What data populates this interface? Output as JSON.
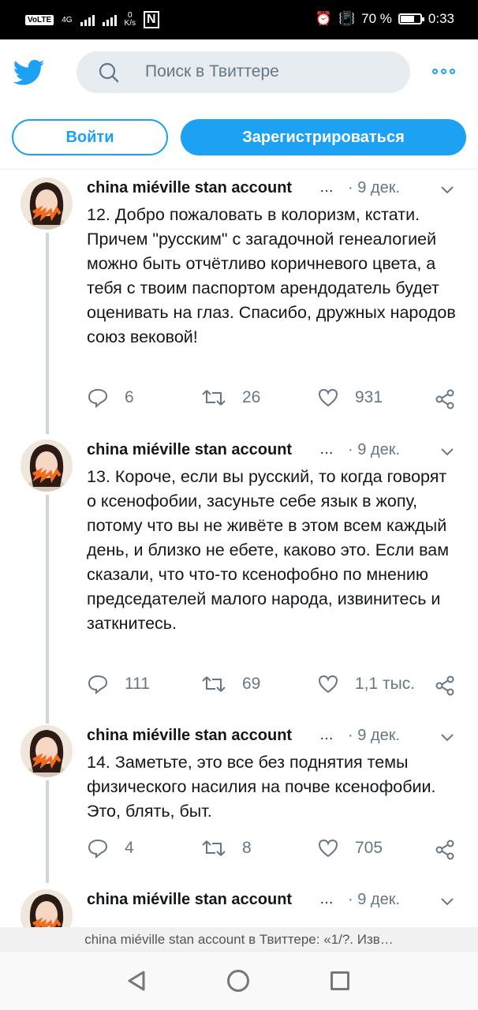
{
  "statusbar": {
    "volte": "VoLTE",
    "network": "4G",
    "speed_value": "0",
    "speed_unit": "K/s",
    "battery": "70 %",
    "battery_level": 0.7,
    "time": "0:33"
  },
  "header": {
    "search_placeholder": "Поиск в Твиттере"
  },
  "auth": {
    "login_label": "Войти",
    "signup_label": "Зарегистрироваться"
  },
  "tweets": [
    {
      "name": "china miéville stan account",
      "dots": "…",
      "date": "· 9 дек.",
      "text": "12. Добро пожаловать в колоризм, кстати. Причем \"русским\" с загадочной генеалогией можно быть отчётливо коричневого цвета, а тебя с твоим паспортом арендодатель будет оценивать на глаз. Спасибо, дружных народов союз вековой!",
      "replies": "6",
      "retweets": "26",
      "likes": "931"
    },
    {
      "name": "china miéville stan account",
      "dots": "…",
      "date": "· 9 дек.",
      "text": "13. Короче, если вы русский, то когда говорят о ксенофобии, засуньте себе язык в жопу, потому что вы не живёте в этом всем каждый день, и близко не ебете, каково это. Если вам сказали, что что-то ксенофобно по мнению председателей малого народа, извинитесь и заткнитесь.",
      "replies": "111",
      "retweets": "69",
      "likes": "1,1 тыс."
    },
    {
      "name": "china miéville stan account",
      "dots": "…",
      "date": "· 9 дек.",
      "text": "14. Заметьте, это все без поднятия темы физического насилия на почве ксенофобии. Это, блять, быт.",
      "replies": "4",
      "retweets": "8",
      "likes": "705"
    },
    {
      "name": "china miéville stan account",
      "dots": "…",
      "date": "· 9 дек.",
      "text": "",
      "replies": "",
      "retweets": "",
      "likes": ""
    }
  ],
  "bottom": {
    "page_title": "china miéville stan account в Твиттере: «1/?. Изв…"
  },
  "colors": {
    "accent": "#1da1f2",
    "secondary_text": "#657786",
    "thread_line": "#ccd6dd"
  }
}
